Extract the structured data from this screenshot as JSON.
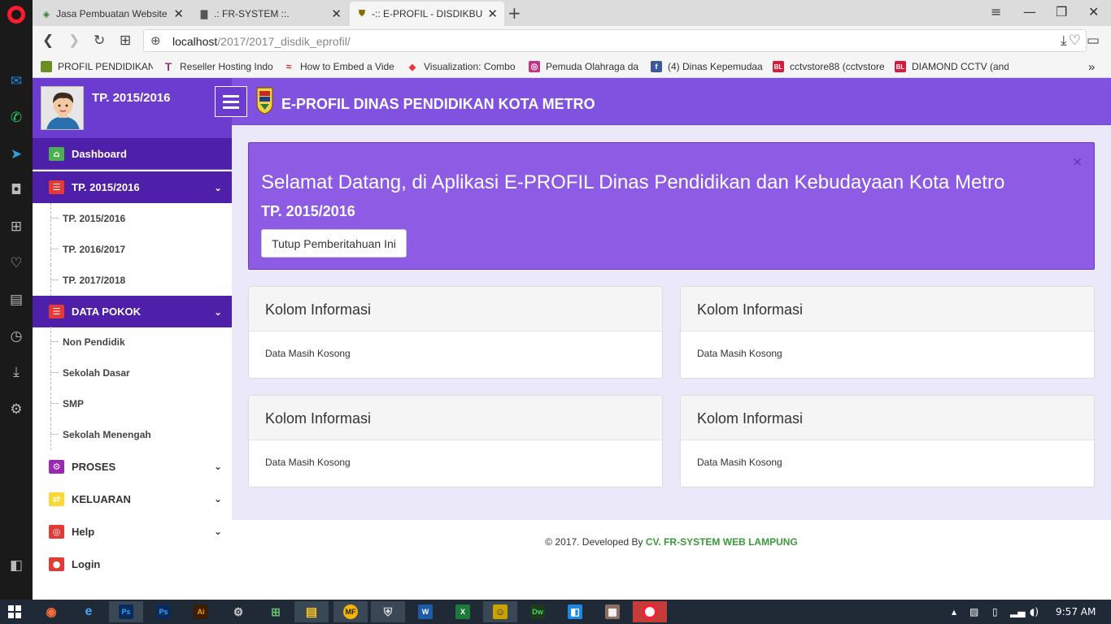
{
  "browser": {
    "tabs": [
      {
        "title": "Jasa Pembuatan Website d",
        "close": "✕"
      },
      {
        "title": ".: FR-SYSTEM ::.",
        "close": "✕"
      },
      {
        "title": "-:: E-PROFIL - DISDIKBUD",
        "close": "✕"
      }
    ],
    "new_tab": "+",
    "url_host": "localhost",
    "url_path": "/2017/2017_disdik_eprofil/",
    "bookmarks": [
      {
        "label": "PROFIL PENDIDIKAN",
        "color": "#6b8e23",
        "glyph": "•"
      },
      {
        "label": "Reseller Hosting Indo",
        "color": "#8e3a7a",
        "glyph": "T"
      },
      {
        "label": "How to Embed a Vide",
        "color": "#d32f2f",
        "glyph": "≈"
      },
      {
        "label": "Visualization: Combo",
        "color": "#ffffff",
        "glyph": "◆"
      },
      {
        "label": "Pemuda Olahraga da",
        "color": "#c13584",
        "glyph": "◎"
      },
      {
        "label": "(4) Dinas Kepemudaa",
        "color": "#3b5998",
        "glyph": "f"
      },
      {
        "label": "cctvstore88 (cctvstore",
        "color": "#d81b3b",
        "glyph": "BL"
      },
      {
        "label": "DIAMOND CCTV (and",
        "color": "#d81b3b",
        "glyph": "BL"
      }
    ],
    "bookmarks_more": "»"
  },
  "sidebar": {
    "user_title": "TP. 2015/2016",
    "items": [
      {
        "label": "Dashboard",
        "icon": "home-icon",
        "glyph": "⌂",
        "color": "#4caf50"
      },
      {
        "label": "TP. 2015/2016",
        "icon": "list-icon",
        "glyph": "☰",
        "color": "#e53935"
      },
      {
        "label": "DATA POKOK",
        "icon": "list-icon",
        "glyph": "☰",
        "color": "#e53935"
      },
      {
        "label": "PROSES",
        "icon": "gears-icon",
        "glyph": "⚙",
        "color": "#9c27b0"
      },
      {
        "label": "KELUARAN",
        "icon": "exchange-icon",
        "glyph": "⇄",
        "color": "#fdd835"
      },
      {
        "label": "Help",
        "icon": "lifebuoy-icon",
        "glyph": "◎",
        "color": "#e53935"
      },
      {
        "label": "Login",
        "icon": "user-icon",
        "glyph": "●",
        "color": "#e53935"
      }
    ],
    "tp_sub": [
      "TP. 2015/2016",
      "TP. 2016/2017",
      "TP. 2017/2018"
    ],
    "data_pokok_sub": [
      "Non Pendidik",
      "Sekolah Dasar",
      "SMP",
      "Sekolah Menengah"
    ],
    "chevron": "⌄"
  },
  "header": {
    "title": "E-PROFIL DINAS PENDIDIKAN KOTA METRO"
  },
  "alert": {
    "close": "×",
    "heading": "Selamat Datang, di Aplikasi E-PROFIL Dinas Pendidikan dan Kebudayaan Kota Metro",
    "subheading": "TP. 2015/2016",
    "button": "Tutup Pemberitahuan Ini"
  },
  "panels": [
    {
      "title": "Kolom Informasi",
      "body": "Data Masih Kosong"
    },
    {
      "title": "Kolom Informasi",
      "body": "Data Masih Kosong"
    },
    {
      "title": "Kolom Informasi",
      "body": "Data Masih Kosong"
    },
    {
      "title": "Kolom Informasi",
      "body": "Data Masih Kosong"
    }
  ],
  "footer": {
    "text": "© 2017. Developed By ",
    "link": "CV. FR-SYSTEM WEB LAMPUNG"
  },
  "taskbar": {
    "clock": "9:57 AM",
    "apps": [
      {
        "name": "firefox",
        "glyph": "◉",
        "color": "#ff7139"
      },
      {
        "name": "ie",
        "glyph": "e",
        "color": "#1e88e5"
      },
      {
        "name": "photoshop",
        "glyph": "Ps",
        "color": "#0a2a5a"
      },
      {
        "name": "photoshop2",
        "glyph": "Ps",
        "color": "#0a2a5a"
      },
      {
        "name": "illustrator",
        "glyph": "Ai",
        "color": "#3b1e00"
      },
      {
        "name": "tool",
        "glyph": "⚙",
        "color": "#555555"
      },
      {
        "name": "network",
        "glyph": "⊞",
        "color": "#2e7d32"
      },
      {
        "name": "explorer",
        "glyph": "▤",
        "color": "#f9a825"
      },
      {
        "name": "mf",
        "glyph": "MF",
        "color": "#f4b400"
      },
      {
        "name": "shield",
        "glyph": "⛨",
        "color": "#666666"
      },
      {
        "name": "word",
        "glyph": "W",
        "color": "#1e5aa8"
      },
      {
        "name": "excel",
        "glyph": "X",
        "color": "#1e7a3c"
      },
      {
        "name": "app",
        "glyph": "☺",
        "color": "#c9a200"
      },
      {
        "name": "dreamweaver",
        "glyph": "Dw",
        "color": "#1b3b1b"
      },
      {
        "name": "app2",
        "glyph": "◧",
        "color": "#1e88e5"
      },
      {
        "name": "notes",
        "glyph": "▦",
        "color": "#8d6e63"
      },
      {
        "name": "opera",
        "glyph": "O",
        "color": "#ff1b2d"
      }
    ]
  }
}
